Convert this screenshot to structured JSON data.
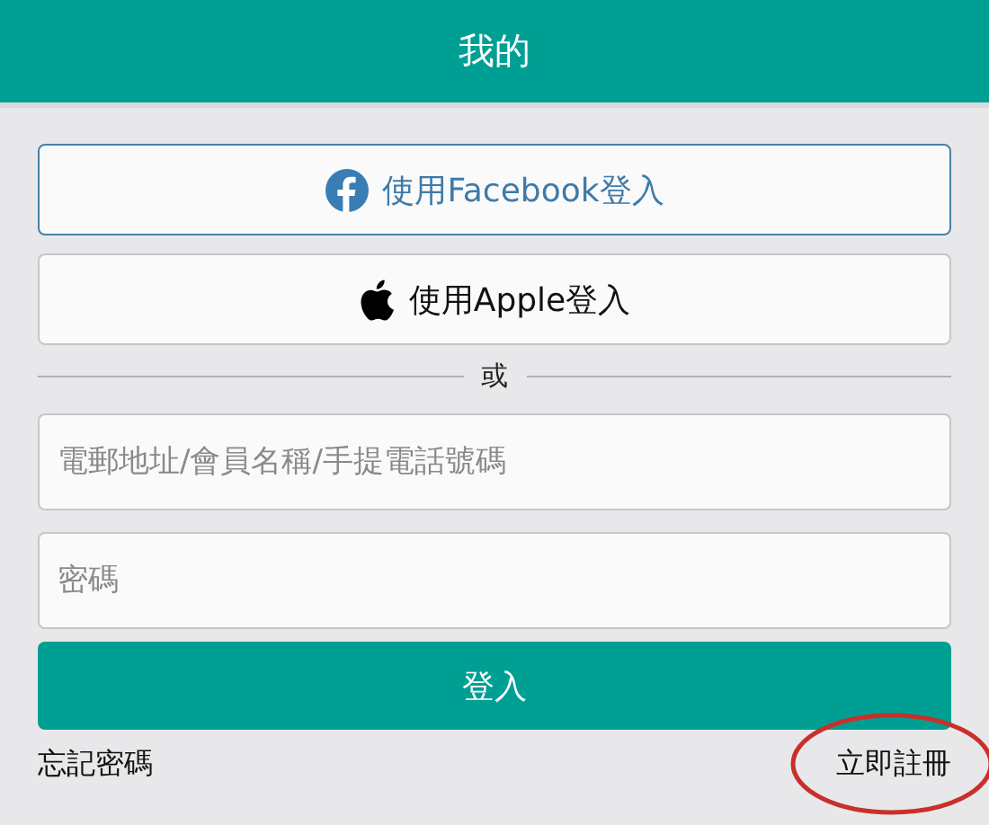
{
  "header": {
    "title": "我的"
  },
  "social_buttons": [
    {
      "kind": "facebook",
      "label": "使用Facebook登入"
    },
    {
      "kind": "apple",
      "label": "使用Apple登入"
    }
  ],
  "divider": {
    "label": "或"
  },
  "fields": [
    {
      "placeholder": "電郵地址/會員名稱/手提電話號碼"
    },
    {
      "placeholder": "密碼"
    }
  ],
  "login_button": {
    "label": "登入"
  },
  "links": {
    "forgot": "忘記密碼",
    "register": "立即註冊",
    "register_circled": true
  }
}
